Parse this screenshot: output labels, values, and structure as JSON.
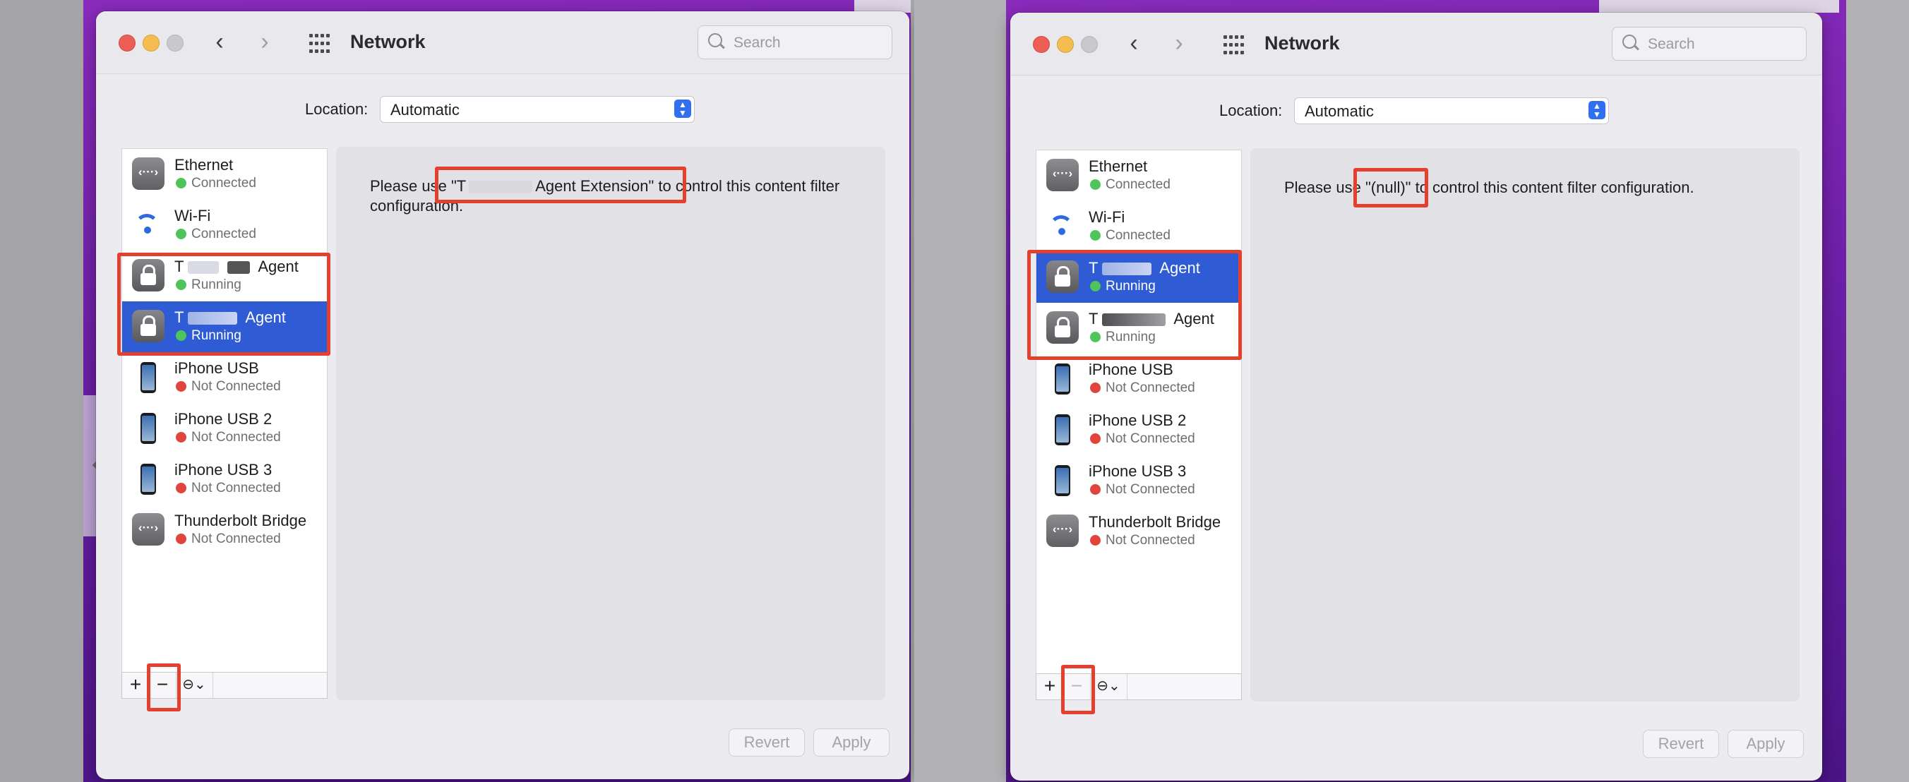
{
  "left": {
    "window_title": "Network",
    "search_placeholder": "Search",
    "location_label": "Location:",
    "location_value": "Automatic",
    "services": [
      {
        "name": "Ethernet",
        "status": "Connected",
        "status_color": "#4fc45a",
        "icon": "ethernet-icon"
      },
      {
        "name": "Wi-Fi",
        "status": "Connected",
        "status_color": "#4fc45a",
        "icon": "wifi-icon"
      },
      {
        "name_prefix": "T",
        "name_suffix": "Agent",
        "status": "Running",
        "status_color": "#4fc45a",
        "icon": "lock-icon"
      },
      {
        "name_prefix": "T",
        "name_suffix": "Agent",
        "status": "Running",
        "status_color": "#4fc45a",
        "icon": "lock-icon",
        "selected": true
      },
      {
        "name": "iPhone USB",
        "status": "Not Connected",
        "status_color": "#e0443c",
        "icon": "iphone-icon"
      },
      {
        "name": "iPhone USB 2",
        "status": "Not Connected",
        "status_color": "#e0443c",
        "icon": "iphone-icon"
      },
      {
        "name": "iPhone USB 3",
        "status": "Not Connected",
        "status_color": "#e0443c",
        "icon": "iphone-icon"
      },
      {
        "name": "Thunderbolt Bridge",
        "status": "Not Connected",
        "status_color": "#e0443c",
        "icon": "thunderbolt-bridge-icon"
      }
    ],
    "message_start": "Please use \"T",
    "message_end": "Agent Extension\" to control this content filter configuration.",
    "buttons": {
      "add": "+",
      "remove": "−",
      "action": "⊖⌄",
      "revert": "Revert",
      "apply": "Apply"
    }
  },
  "right": {
    "window_title": "Network",
    "search_placeholder": "Search",
    "location_label": "Location:",
    "location_value": "Automatic",
    "services": [
      {
        "name": "Ethernet",
        "status": "Connected",
        "status_color": "#4fc45a",
        "icon": "ethernet-icon"
      },
      {
        "name": "Wi-Fi",
        "status": "Connected",
        "status_color": "#4fc45a",
        "icon": "wifi-icon"
      },
      {
        "name_prefix": "T",
        "name_suffix": "Agent",
        "status": "Running",
        "status_color": "#4fc45a",
        "icon": "lock-icon",
        "selected": true
      },
      {
        "name_prefix": "T",
        "name_suffix": "Agent",
        "status": "Running",
        "status_color": "#4fc45a",
        "icon": "lock-icon"
      },
      {
        "name": "iPhone USB",
        "status": "Not Connected",
        "status_color": "#e0443c",
        "icon": "iphone-icon"
      },
      {
        "name": "iPhone USB 2",
        "status": "Not Connected",
        "status_color": "#e0443c",
        "icon": "iphone-icon"
      },
      {
        "name": "iPhone USB 3",
        "status": "Not Connected",
        "status_color": "#e0443c",
        "icon": "iphone-icon"
      },
      {
        "name": "Thunderbolt Bridge",
        "status": "Not Connected",
        "status_color": "#e0443c",
        "icon": "thunderbolt-bridge-icon"
      }
    ],
    "message": "Please use \"(null)\" to control this content filter configuration.",
    "buttons": {
      "add": "+",
      "remove": "−",
      "action": "⊖⌄",
      "revert": "Revert",
      "apply": "Apply"
    }
  },
  "colors": {
    "highlight": "#e3402e",
    "selection": "#2f5cd4",
    "accent": "#2f6ff0"
  }
}
